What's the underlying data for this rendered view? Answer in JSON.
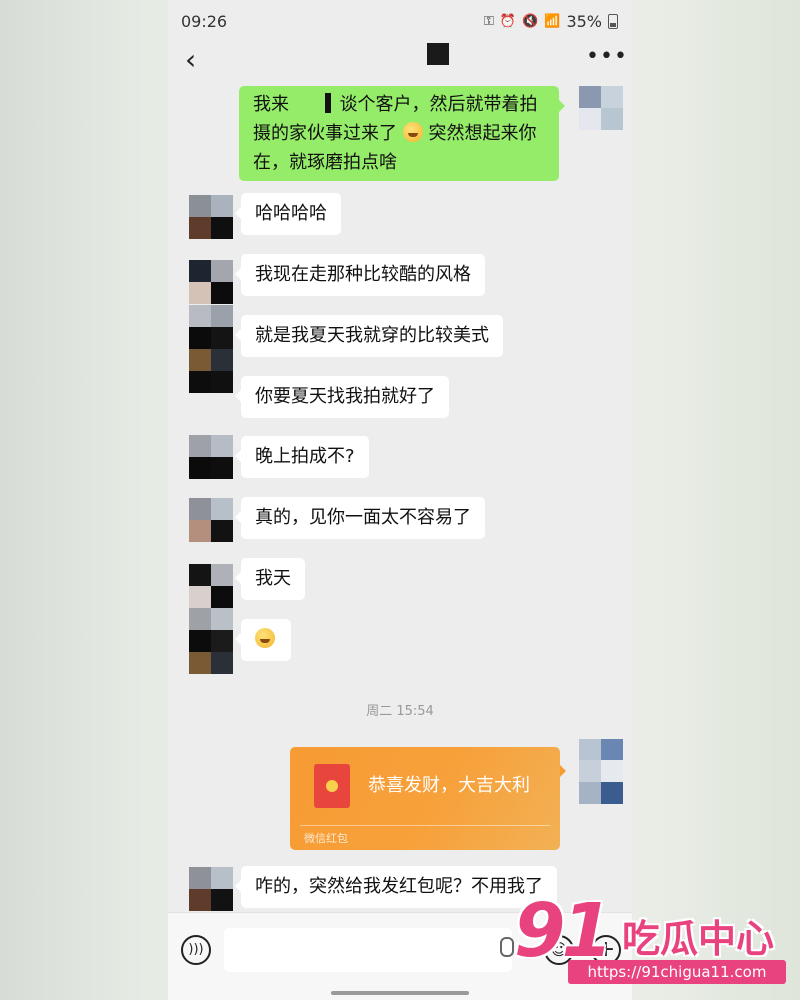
{
  "status_bar": {
    "time": "09:26",
    "battery": "35%"
  },
  "nav": {
    "back_icon": "back-chevron-icon",
    "more_icon": "more-icon"
  },
  "messages": [
    {
      "side": "right",
      "text_parts": [
        "我来",
        "谈个客户，然后就带着拍摄的家伙事过来了",
        "突然想起来你在，就琢磨拍点啥"
      ]
    },
    {
      "side": "left",
      "text": "哈哈哈哈"
    },
    {
      "side": "left",
      "text": "我现在走那种比较酷的风格"
    },
    {
      "side": "left",
      "text": "就是我夏天我就穿的比较美式"
    },
    {
      "side": "left",
      "text": "你要夏天找我拍就好了"
    },
    {
      "side": "left",
      "text": "晚上拍成不?"
    },
    {
      "side": "left",
      "text": "真的，见你一面太不容易了"
    },
    {
      "side": "left",
      "text": "我天"
    },
    {
      "side": "left",
      "text": "",
      "emoji": "grimace-emoji"
    },
    {
      "side": "left",
      "text": "咋的，突然给我发红包呢？不用我了"
    }
  ],
  "timestamp": "周二 15:54",
  "red_packet": {
    "title": "恭喜发财，大吉大利",
    "footer": "微信红包",
    "color": "#f79b33"
  },
  "bottom_bar": {
    "voice_icon": "voice-icon",
    "mic_icon": "mic-icon",
    "emoji_icon": "smiley-icon",
    "plus_icon": "plus-icon"
  },
  "watermark": {
    "number": "91",
    "brand": "吃瓜中心",
    "url": "https://91chigua11.com"
  },
  "colors": {
    "green_bubble": "#95ec69",
    "accent_watermark": "#e9437f"
  }
}
